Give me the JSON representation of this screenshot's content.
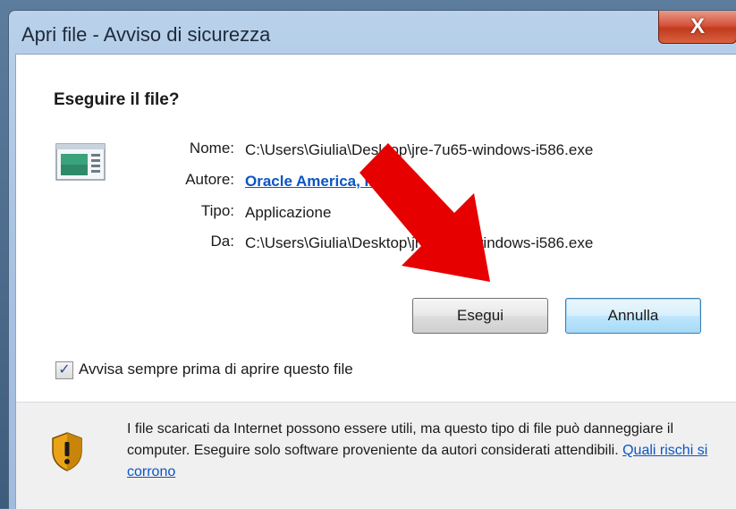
{
  "dialog": {
    "title": "Apri file - Avviso di sicurezza",
    "close_label": "X",
    "heading": "Eseguire il file?",
    "fields": [
      {
        "label": "Nome:",
        "value": "C:\\Users\\Giulia\\Desktop\\jre-7u65-windows-i586.exe",
        "link": false
      },
      {
        "label": "Autore:",
        "value": "Oracle America, Inc.",
        "link": true
      },
      {
        "label": "Tipo:",
        "value": "Applicazione",
        "link": false
      },
      {
        "label": "Da:",
        "value": "C:\\Users\\Giulia\\Desktop\\jre-7u65-windows-i586.exe",
        "link": false
      }
    ],
    "run_button": "Esegui",
    "cancel_button": "Annulla",
    "checkbox_label": "Avvisa sempre prima di aprire questo file",
    "checkbox_checked": true,
    "footer_text": "I file scaricati da Internet possono essere utili, ma questo tipo di file può danneggiare il computer. Eseguire solo software proveniente da autori considerati attendibili.",
    "footer_link": "Quali rischi si corrono"
  },
  "icons": {
    "file": "application-file-icon",
    "warning": "security-shield-icon",
    "annotation": "red-arrow"
  },
  "colors": {
    "link": "#0b55c4",
    "close_button": "#c23a1f",
    "annotation_arrow": "#e60000"
  }
}
